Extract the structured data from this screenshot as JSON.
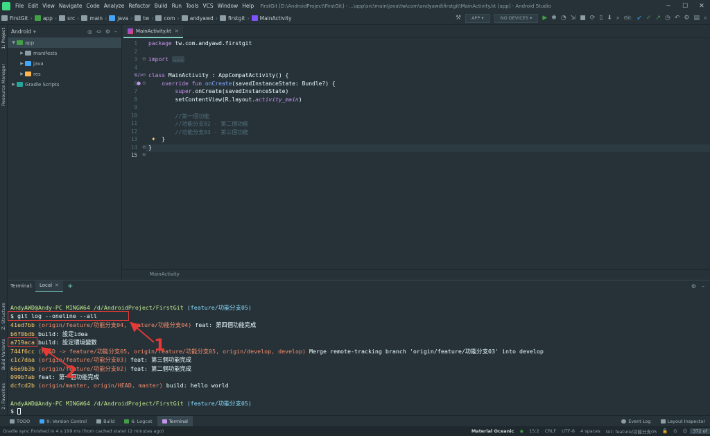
{
  "window": {
    "title": "FirstGit [D:\\AndroidProject\\FirstGit] - ...\\app\\src\\main\\java\\tw\\com\\andyawd\\firstgit\\MainActivity.kt [app] - Android Studio",
    "menu": [
      "File",
      "Edit",
      "View",
      "Navigate",
      "Code",
      "Analyze",
      "Refactor",
      "Build",
      "Run",
      "Tools",
      "VCS",
      "Window",
      "Help"
    ]
  },
  "breadcrumb": [
    "FirstGit",
    "app",
    "src",
    "main",
    "java",
    "tw",
    "com",
    "andyawd",
    "firstgit",
    "MainActivity"
  ],
  "toolbar": {
    "config": "APP",
    "devices": "NO DEVICES",
    "git_label": "Git:"
  },
  "left_strip": {
    "project": "1: Project",
    "resource_manager": "Resource Manager",
    "structure": "Z: Structure",
    "build_variants": "Build Variants",
    "favorites": "2: Favorites"
  },
  "project_panel": {
    "view": "Android",
    "tree": [
      {
        "label": "app",
        "level": 0
      },
      {
        "label": "manifests",
        "level": 1
      },
      {
        "label": "java",
        "level": 1
      },
      {
        "label": "res",
        "level": 1
      },
      {
        "label": "Gradle Scripts",
        "level": 0
      }
    ]
  },
  "editor": {
    "tab": "MainActivity.kt",
    "line_numbers": [
      "1",
      "2",
      "3",
      "4",
      "5",
      "6",
      "7",
      "8",
      "9",
      "10",
      "11",
      "12",
      "13",
      "14",
      "15"
    ],
    "code": {
      "l1_kw": "package",
      "l1_rest": " tw.com.andyawd.firstgit",
      "l3_kw": "import",
      "l3_fold": "...",
      "l6_kw": "class",
      "l6_rest": " MainActivity : AppCompatActivity() {",
      "l7_kw": "    override fun ",
      "l7_fn": "onCreate",
      "l7_rest": "(savedInstanceState: Bundle?) {",
      "l8_kw": "        super",
      "l8_rest": ".onCreate(savedInstanceState)",
      "l9_a": "        setContentView(R.layout.",
      "l9_it": "activity_main",
      "l9_b": ")",
      "l11": "        //第一個功能",
      "l12": "        //功能分支02 - 第二個功能",
      "l13": "        //功能分支03 - 第三個功能",
      "l14": "    }",
      "l15": "}"
    },
    "breadcrumb": "MainActivity"
  },
  "terminal": {
    "label": "Terminal:",
    "tab": "Local",
    "prompt1_user": "AndyAWD@Andy-PC MINGW64 /d/AndroidProject/FirstGit",
    "prompt1_branch": " (feature/功能分支05)",
    "command": "$ git log --oneline --all",
    "log": [
      {
        "hash": "41ed7bb",
        "refs": " (origin/feature/功能分支04, feature/功能分支04)",
        "msg": " feat: 第四個功能完成"
      },
      {
        "hash": "b6f0bdb",
        "refs": "",
        "msg": " build: 設定idea"
      },
      {
        "hash": "a719aca",
        "refs": "",
        "msg": " build: 設定環境變數"
      },
      {
        "hash": "744f6cc",
        "refs": " (HEAD -> feature/功能分支05, origin/feature/功能分支05, origin/develop, develop)",
        "msg": " Merge remote-tracking branch 'origin/feature/功能分支03' into develop"
      },
      {
        "hash": "c1c7daa",
        "refs": " (origin/feature/功能分支03)",
        "msg": " feat: 第三個功能完成"
      },
      {
        "hash": "66e9b3b",
        "refs": " (origin/feature/功能分支02)",
        "msg": " feat: 第二個功能完成"
      },
      {
        "hash": "099b7ab",
        "refs": "",
        "msg": " feat: 第一個功能完成"
      },
      {
        "hash": "dcfcd2b",
        "refs": " (origin/master, origin/HEAD, master)",
        "msg": " build: hello world"
      }
    ],
    "prompt2_user": "AndyAWD@Andy-PC MINGW64 /d/AndroidProject/FirstGit",
    "prompt2_branch": " (feature/功能分支05)",
    "prompt_char": "$ "
  },
  "annotations": {
    "one": "1",
    "two": "2"
  },
  "tool_windows": [
    "TODO",
    "9: Version Control",
    "Build",
    "6: Logcat",
    "Terminal"
  ],
  "tool_windows_right": [
    "Event Log",
    "Layout Inspector"
  ],
  "status": {
    "message": "Gradle sync finished in 4 s 199 ms (from cached state) (2 minutes ago)",
    "theme": "Material Oceanic",
    "position": "15:2",
    "line_sep": "CRLF",
    "encoding": "UTF-8",
    "indent": "4 spaces",
    "git_branch": "Git: feature/功能分支05",
    "memory": "372 of"
  },
  "colors": {
    "background": "#263238",
    "accent": "#80cbc4",
    "annotation": "#e53935"
  }
}
